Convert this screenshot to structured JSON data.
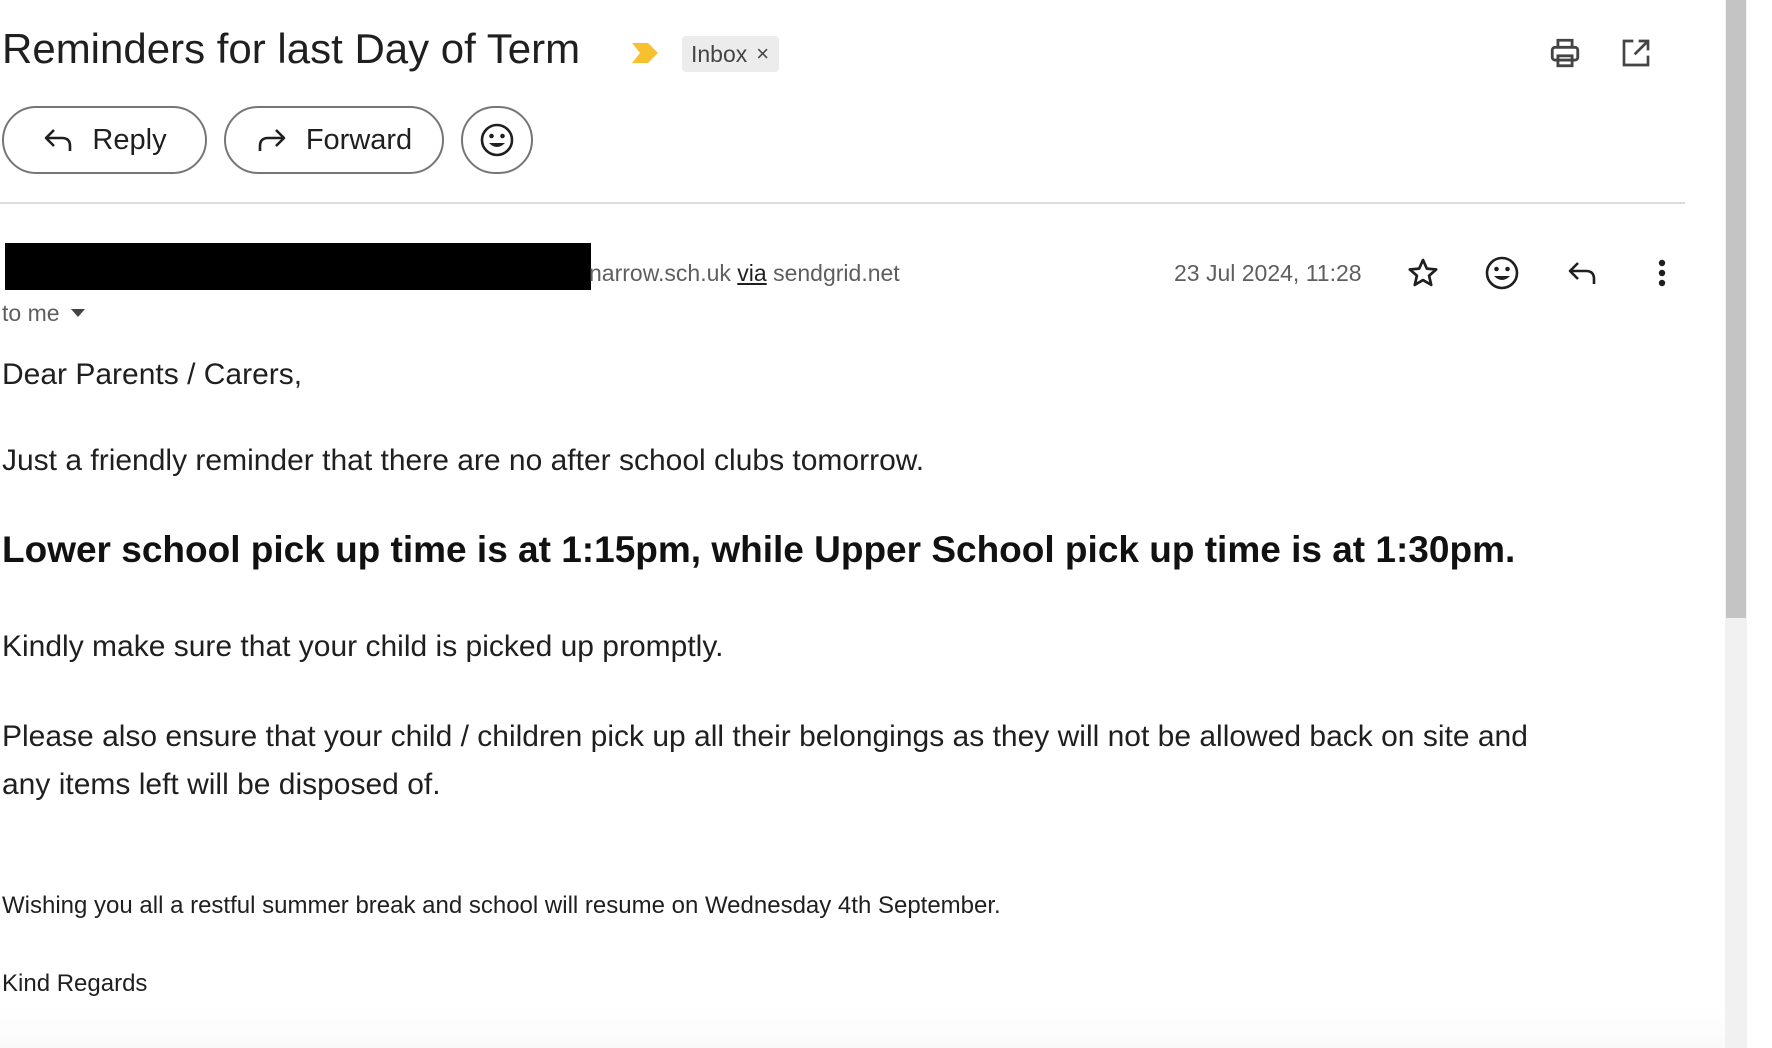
{
  "email": {
    "subject": "Reminders for last Day of Term",
    "label": "Inbox",
    "label_remove": "×"
  },
  "actions": {
    "reply_label": "Reply",
    "forward_label": "Forward"
  },
  "sender": {
    "address_visible": "narrow.sch.uk",
    "via_label": "via",
    "via_domain": "sendgrid.net",
    "date": "23 Jul 2024, 11:28",
    "recipient": "to me"
  },
  "body": {
    "greeting": "Dear Parents / Carers,",
    "line1": "Just a friendly reminder that there are no after school clubs tomorrow.",
    "bold_line": "Lower school pick up time is at 1:15pm, while Upper School pick up time is at 1:30pm.",
    "line2": "Kindly make sure that your child is picked up promptly.",
    "line3a": "Please also ensure that your child / children pick up all their belongings as they will not be allowed back on site and",
    "line3b": "any items left will be disposed of.",
    "closing1": "Wishing you all a restful summer break and school will resume on Wednesday 4th September.",
    "closing2": "Kind Regards"
  },
  "icons": {
    "importance": "importance-marker-icon",
    "print": "print-icon",
    "open_new": "open-in-new-window-icon",
    "emoji": "emoji-icon",
    "star": "star-icon",
    "reply": "reply-icon",
    "more": "more-vert-icon",
    "dropdown": "chevron-down-icon"
  },
  "colors": {
    "importance": "#f6c02e",
    "chip_bg": "#ececec",
    "border": "#747775",
    "secondary_text": "#5e5e5e"
  }
}
